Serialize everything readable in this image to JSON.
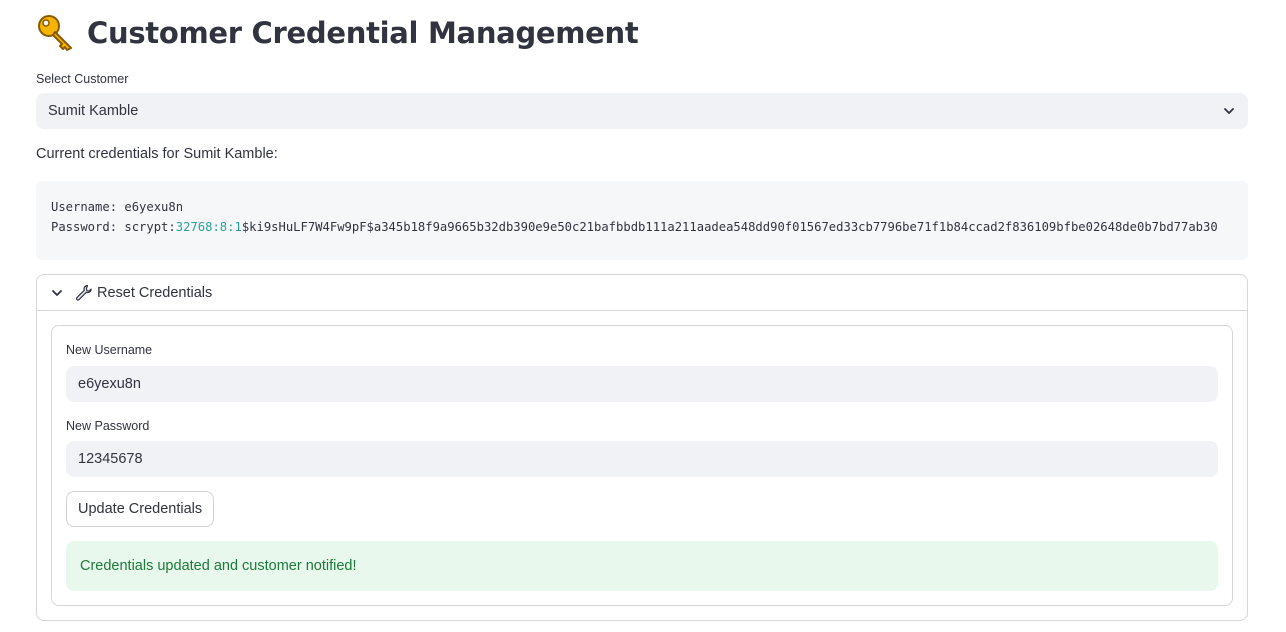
{
  "header": {
    "title": "Customer Credential Management"
  },
  "customer_select": {
    "label": "Select Customer",
    "selected": "Sumit Kamble"
  },
  "current_credentials": {
    "heading": "Current credentials for Sumit Kamble:",
    "username_key": "Username: ",
    "username_value": "e6yexu8n",
    "password_key": "Password: ",
    "password_prefix": "scrypt:",
    "password_n": "32768",
    "password_sep1": ":",
    "password_r": "8",
    "password_sep2": ":",
    "password_p": "1",
    "password_rest": "$ki9sHuLF7W4Fw9pF$a345b18f9a9665b32db390e9e50c21bafbbdb111a211aadea548dd90f01567ed33cb7796be71f1b84ccad2f836109bfbe02648de0b7bd77ab30"
  },
  "reset_expander": {
    "label": "Reset Credentials",
    "new_username_label": "New Username",
    "new_username_value": "e6yexu8n",
    "new_password_label": "New Password",
    "new_password_value": "12345678",
    "update_button": "Update Credentials",
    "success_message": "Credentials updated and customer notified!"
  },
  "colors": {
    "accent_number": "#2aa198",
    "success_bg": "#e8f8ec",
    "success_text": "#1d7a3a",
    "input_bg": "#f0f2f6"
  },
  "icons": {
    "title": "key-icon",
    "select": "chevron-down-icon",
    "expander_toggle": "chevron-down-icon",
    "expander": "wrench-icon"
  }
}
